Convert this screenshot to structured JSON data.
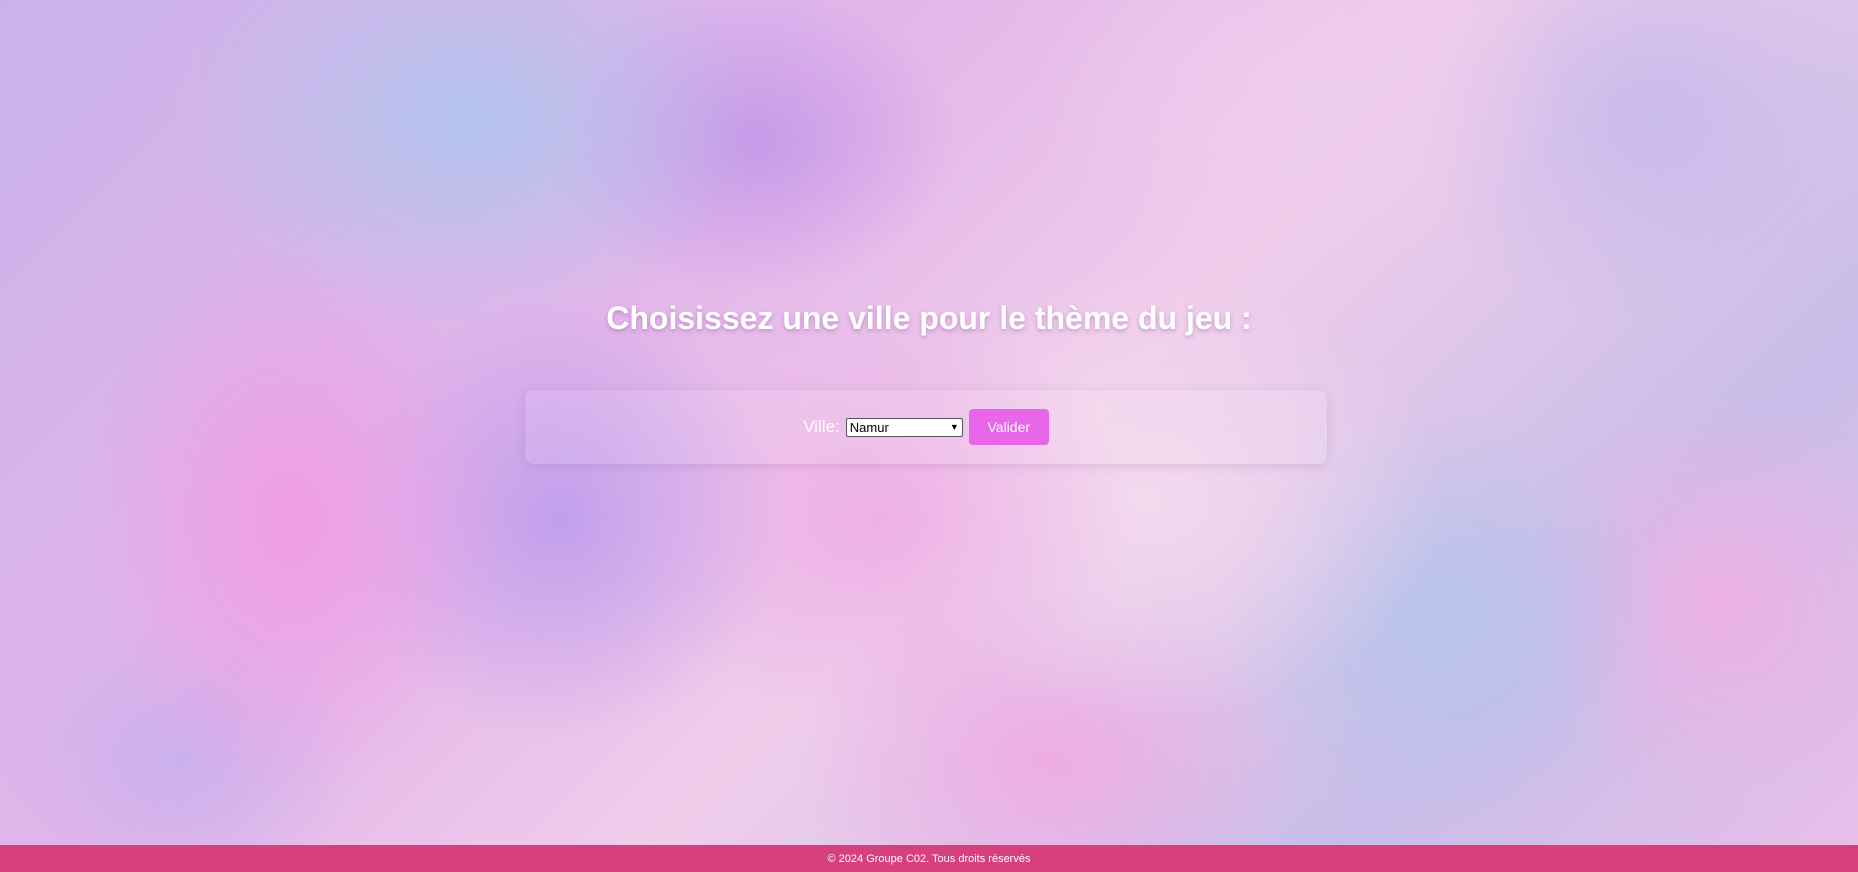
{
  "main": {
    "title": "Choisissez une ville pour le thème du jeu :"
  },
  "form": {
    "ville_label": "Ville:",
    "ville_selected": "Namur",
    "submit_label": "Valider"
  },
  "footer": {
    "text": "© 2024 Groupe C02. Tous droits réservés"
  },
  "colors": {
    "button": "#e866e8",
    "footer": "#d6407c",
    "text": "#ffffff"
  },
  "icons": {
    "select_arrow": "chevron-down-icon"
  }
}
